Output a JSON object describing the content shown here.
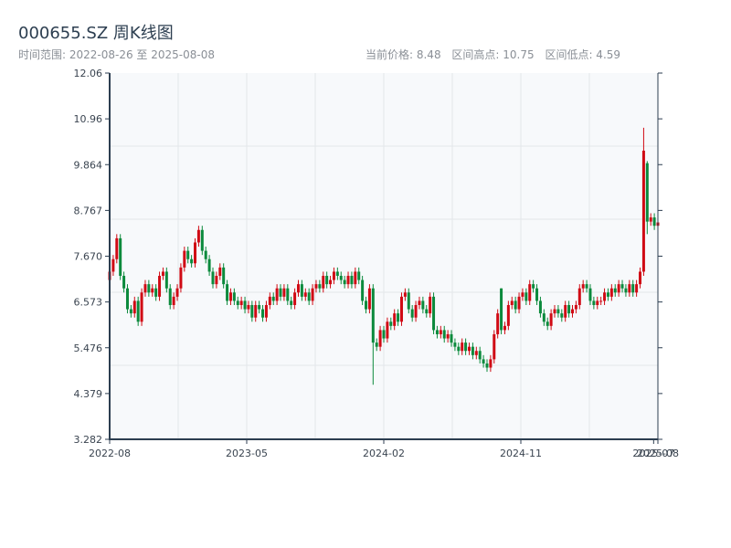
{
  "header": {
    "title": "000655.SZ 周K线图",
    "range_label": "时间范围: 2022-08-26 至 2025-08-08",
    "current_price": "当前价格: 8.48",
    "range_high": "区间高点: 10.75",
    "range_low": "区间低点: 4.59"
  },
  "colors": {
    "up": "#d00a14",
    "down": "#0b8a3c",
    "axis": "#2c3e50",
    "grid": "#e3e6ea",
    "plot_bg": "#f7f9fb"
  },
  "chart_data": {
    "type": "candlestick",
    "title": "000655.SZ 周K线图",
    "start_date": "2022-08-26",
    "end_date": "2025-08-08",
    "ylim": [
      3.282,
      12.06
    ],
    "yticks": [
      "3.282",
      "4.379",
      "5.476",
      "6.573",
      "7.670",
      "8.767",
      "9.864",
      "10.96",
      "12.06"
    ],
    "xlim_weeks": [
      0,
      154
    ],
    "xticks": [
      {
        "label": "2022-08",
        "week": 0
      },
      {
        "label": "2023-05",
        "week": 38.5
      },
      {
        "label": "2024-02",
        "week": 77
      },
      {
        "label": "2024-11",
        "week": 115.5
      },
      {
        "label": "2025-07",
        "week": 152.8
      },
      {
        "label": "2025-08",
        "week": 154
      }
    ],
    "grid": true,
    "open": [
      7.1,
      7.3,
      7.6,
      8.1,
      7.2,
      6.9,
      6.4,
      6.3,
      6.6,
      6.1,
      6.8,
      7.0,
      6.8,
      6.9,
      6.7,
      7.2,
      7.3,
      6.9,
      6.5,
      6.7,
      6.9,
      7.4,
      7.8,
      7.6,
      7.5,
      8.0,
      8.3,
      7.8,
      7.6,
      7.3,
      7.0,
      7.2,
      7.4,
      7.0,
      6.6,
      6.8,
      6.6,
      6.5,
      6.6,
      6.4,
      6.5,
      6.2,
      6.5,
      6.4,
      6.2,
      6.5,
      6.7,
      6.6,
      6.9,
      6.7,
      6.9,
      6.6,
      6.5,
      6.8,
      7.0,
      6.7,
      6.8,
      6.6,
      6.9,
      7.0,
      6.9,
      7.2,
      7.0,
      7.1,
      7.3,
      7.2,
      7.1,
      7.0,
      7.2,
      7.0,
      7.3,
      7.1,
      6.6,
      6.4,
      6.9,
      5.6,
      5.5,
      5.9,
      5.7,
      6.1,
      6.0,
      6.3,
      6.1,
      6.7,
      6.8,
      6.4,
      6.2,
      6.5,
      6.6,
      6.4,
      6.3,
      6.7,
      5.9,
      5.8,
      5.9,
      5.7,
      5.8,
      5.6,
      5.5,
      5.4,
      5.6,
      5.4,
      5.5,
      5.3,
      5.4,
      5.2,
      5.1,
      5.0,
      5.2,
      5.8,
      6.9,
      5.9,
      6.0,
      6.5,
      6.6,
      6.4,
      6.7,
      6.8,
      6.6,
      7.0,
      6.9,
      6.6,
      6.3,
      6.1,
      6.0,
      6.3,
      6.4,
      6.3,
      6.2,
      6.5,
      6.3,
      6.4,
      6.5,
      6.9,
      7.0,
      6.9,
      6.6,
      6.5,
      6.6,
      6.6,
      6.8,
      6.7,
      6.9,
      6.8,
      7.0,
      6.9,
      6.8,
      7.0,
      6.8,
      7.0,
      7.3,
      9.9,
      8.5,
      8.6,
      8.4
    ],
    "close": [
      7.3,
      7.6,
      8.1,
      7.2,
      6.9,
      6.4,
      6.3,
      6.6,
      6.1,
      6.8,
      7.0,
      6.8,
      6.9,
      6.7,
      7.2,
      7.3,
      6.9,
      6.5,
      6.7,
      6.9,
      7.4,
      7.8,
      7.6,
      7.5,
      8.0,
      8.3,
      7.8,
      7.6,
      7.3,
      7.0,
      7.2,
      7.4,
      7.0,
      6.6,
      6.8,
      6.6,
      6.5,
      6.6,
      6.4,
      6.5,
      6.2,
      6.5,
      6.4,
      6.2,
      6.5,
      6.7,
      6.6,
      6.9,
      6.7,
      6.9,
      6.6,
      6.5,
      6.8,
      7.0,
      6.7,
      6.8,
      6.6,
      6.9,
      7.0,
      6.9,
      7.2,
      7.0,
      7.1,
      7.3,
      7.2,
      7.1,
      7.0,
      7.2,
      7.0,
      7.3,
      7.1,
      6.6,
      6.4,
      6.9,
      5.6,
      5.5,
      5.9,
      5.7,
      6.1,
      6.0,
      6.3,
      6.1,
      6.7,
      6.8,
      6.4,
      6.2,
      6.5,
      6.6,
      6.4,
      6.3,
      6.7,
      5.9,
      5.8,
      5.9,
      5.7,
      5.8,
      5.6,
      5.5,
      5.4,
      5.6,
      5.4,
      5.5,
      5.3,
      5.4,
      5.2,
      5.1,
      5.0,
      5.2,
      5.8,
      6.3,
      5.9,
      6.0,
      6.5,
      6.6,
      6.4,
      6.7,
      6.8,
      6.6,
      7.0,
      6.9,
      6.6,
      6.3,
      6.1,
      6.0,
      6.3,
      6.4,
      6.3,
      6.2,
      6.5,
      6.3,
      6.4,
      6.5,
      6.9,
      7.0,
      6.9,
      6.6,
      6.5,
      6.6,
      6.6,
      6.8,
      6.7,
      6.9,
      6.8,
      7.0,
      6.9,
      6.8,
      7.0,
      6.8,
      7.0,
      7.3,
      10.2,
      8.5,
      8.6,
      8.4,
      8.48
    ],
    "default_wick": 0.1,
    "high_overrides": {
      "2": 8.2,
      "25": 8.4,
      "110": 6.9,
      "150": 10.75,
      "151": 9.95
    },
    "low_overrides": {
      "74": 4.59,
      "150": 7.2,
      "151": 8.2
    }
  }
}
